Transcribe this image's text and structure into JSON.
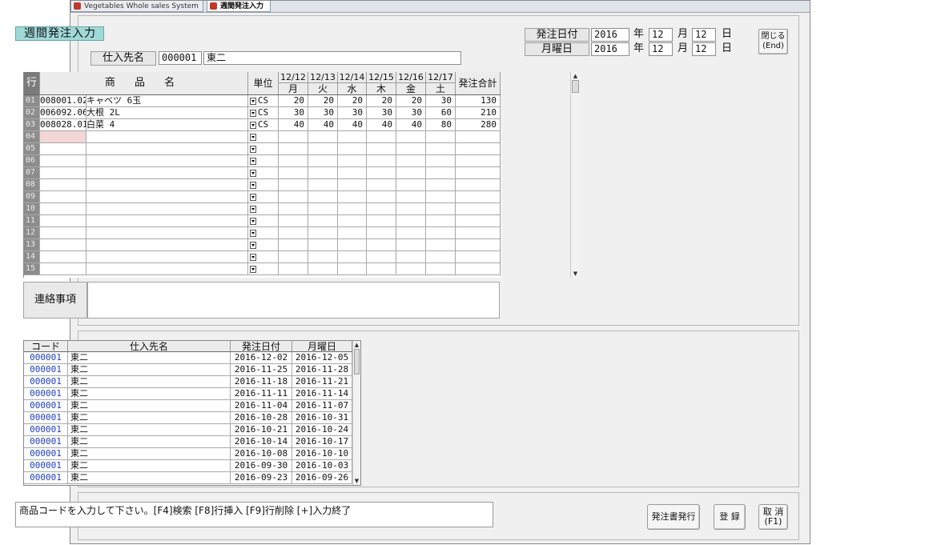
{
  "tabs": [
    {
      "label": "Vegetables Whole sales System",
      "icon": "app-icon"
    },
    {
      "label": "週間発注入力",
      "icon": "app-icon"
    }
  ],
  "form": {
    "title": "週間発注入力",
    "supplier_label": "仕入先名",
    "supplier_code": "000001",
    "supplier_name": "東二",
    "order_date_label": "発注日付",
    "order_date": {
      "year": "2016",
      "month": "12",
      "day": "12"
    },
    "monday_label": "月曜日",
    "monday_date": {
      "year": "2016",
      "month": "12",
      "day": "12"
    },
    "year_unit": "年",
    "month_unit": "月",
    "day_unit": "日",
    "close_button": {
      "line1": "閉じる",
      "line2": "(End)"
    }
  },
  "order_grid": {
    "headers": {
      "row": "行",
      "product": "商 品 名",
      "unit": "単位",
      "total": "発注合計",
      "days": [
        {
          "date": "12/12",
          "weekday": "月"
        },
        {
          "date": "12/13",
          "weekday": "火"
        },
        {
          "date": "12/14",
          "weekday": "水"
        },
        {
          "date": "12/15",
          "weekday": "木"
        },
        {
          "date": "12/16",
          "weekday": "金"
        },
        {
          "date": "12/17",
          "weekday": "土"
        }
      ]
    },
    "rows": [
      {
        "no": "01",
        "code": "008001.02",
        "name": "キャベツ 6玉",
        "unit": "CS",
        "qty": [
          "20",
          "20",
          "20",
          "20",
          "20",
          "30"
        ],
        "total": "130"
      },
      {
        "no": "02",
        "code": "006092.06",
        "name": "大根 2L",
        "unit": "CS",
        "qty": [
          "30",
          "30",
          "30",
          "30",
          "30",
          "60"
        ],
        "total": "210"
      },
      {
        "no": "03",
        "code": "008028.01",
        "name": "白菜 4",
        "unit": "CS",
        "qty": [
          "40",
          "40",
          "40",
          "40",
          "40",
          "80"
        ],
        "total": "280"
      },
      {
        "no": "04",
        "code": "",
        "name": "",
        "unit": "",
        "qty": [
          "",
          "",
          "",
          "",
          "",
          ""
        ],
        "total": ""
      },
      {
        "no": "05",
        "code": "",
        "name": "",
        "unit": "",
        "qty": [
          "",
          "",
          "",
          "",
          "",
          ""
        ],
        "total": ""
      },
      {
        "no": "06",
        "code": "",
        "name": "",
        "unit": "",
        "qty": [
          "",
          "",
          "",
          "",
          "",
          ""
        ],
        "total": ""
      },
      {
        "no": "07",
        "code": "",
        "name": "",
        "unit": "",
        "qty": [
          "",
          "",
          "",
          "",
          "",
          ""
        ],
        "total": ""
      },
      {
        "no": "08",
        "code": "",
        "name": "",
        "unit": "",
        "qty": [
          "",
          "",
          "",
          "",
          "",
          ""
        ],
        "total": ""
      },
      {
        "no": "09",
        "code": "",
        "name": "",
        "unit": "",
        "qty": [
          "",
          "",
          "",
          "",
          "",
          ""
        ],
        "total": ""
      },
      {
        "no": "10",
        "code": "",
        "name": "",
        "unit": "",
        "qty": [
          "",
          "",
          "",
          "",
          "",
          ""
        ],
        "total": ""
      },
      {
        "no": "11",
        "code": "",
        "name": "",
        "unit": "",
        "qty": [
          "",
          "",
          "",
          "",
          "",
          ""
        ],
        "total": ""
      },
      {
        "no": "12",
        "code": "",
        "name": "",
        "unit": "",
        "qty": [
          "",
          "",
          "",
          "",
          "",
          ""
        ],
        "total": ""
      },
      {
        "no": "13",
        "code": "",
        "name": "",
        "unit": "",
        "qty": [
          "",
          "",
          "",
          "",
          "",
          ""
        ],
        "total": ""
      },
      {
        "no": "14",
        "code": "",
        "name": "",
        "unit": "",
        "qty": [
          "",
          "",
          "",
          "",
          "",
          ""
        ],
        "total": ""
      },
      {
        "no": "15",
        "code": "",
        "name": "",
        "unit": "",
        "qty": [
          "",
          "",
          "",
          "",
          "",
          ""
        ],
        "total": ""
      }
    ]
  },
  "memo": {
    "label": "連絡事項",
    "value": ""
  },
  "history": {
    "headers": {
      "code": "コード",
      "supplier": "仕入先名",
      "order_date": "発注日付",
      "monday": "月曜日"
    },
    "rows": [
      {
        "code": "000001",
        "supplier": "東二",
        "order_date": "2016-12-02",
        "monday": "2016-12-05"
      },
      {
        "code": "000001",
        "supplier": "東二",
        "order_date": "2016-11-25",
        "monday": "2016-11-28"
      },
      {
        "code": "000001",
        "supplier": "東二",
        "order_date": "2016-11-18",
        "monday": "2016-11-21"
      },
      {
        "code": "000001",
        "supplier": "東二",
        "order_date": "2016-11-11",
        "monday": "2016-11-14"
      },
      {
        "code": "000001",
        "supplier": "東二",
        "order_date": "2016-11-04",
        "monday": "2016-11-07"
      },
      {
        "code": "000001",
        "supplier": "東二",
        "order_date": "2016-10-28",
        "monday": "2016-10-31"
      },
      {
        "code": "000001",
        "supplier": "東二",
        "order_date": "2016-10-21",
        "monday": "2016-10-24"
      },
      {
        "code": "000001",
        "supplier": "東二",
        "order_date": "2016-10-14",
        "monday": "2016-10-17"
      },
      {
        "code": "000001",
        "supplier": "東二",
        "order_date": "2016-10-08",
        "monday": "2016-10-10"
      },
      {
        "code": "000001",
        "supplier": "東二",
        "order_date": "2016-09-30",
        "monday": "2016-10-03"
      },
      {
        "code": "000001",
        "supplier": "東二",
        "order_date": "2016-09-23",
        "monday": "2016-09-26"
      }
    ]
  },
  "status_message": "商品コードを入力して下さい。[F4]検索 [F8]行挿入 [F9]行削除 [+]入力終了",
  "buttons": {
    "issue_order": "発注書発行",
    "register": "登 録",
    "cancel_line1": "取 消",
    "cancel_line2": "(F1)"
  },
  "colors": {
    "title_bg": "#9fd9d8",
    "row_header_bg": "#8d8d8d",
    "active_cell_bg": "#f3d6d6",
    "code_text": "#1f3fbf"
  }
}
